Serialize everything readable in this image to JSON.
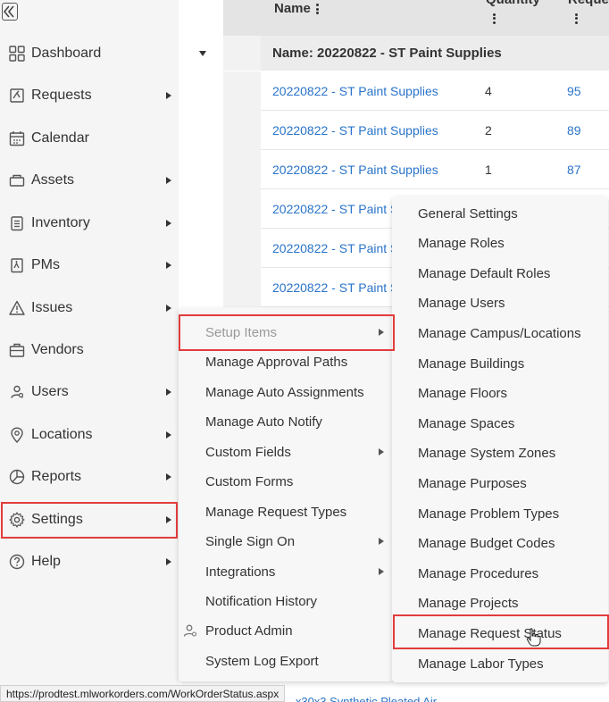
{
  "sidebar": {
    "items": [
      {
        "label": "Dashboard",
        "icon": "dashboard-icon",
        "arrow": false
      },
      {
        "label": "Requests",
        "icon": "requests-icon",
        "arrow": true
      },
      {
        "label": "Calendar",
        "icon": "calendar-icon",
        "arrow": false
      },
      {
        "label": "Assets",
        "icon": "assets-icon",
        "arrow": true
      },
      {
        "label": "Inventory",
        "icon": "inventory-icon",
        "arrow": true
      },
      {
        "label": "PMs",
        "icon": "pms-icon",
        "arrow": true
      },
      {
        "label": "Issues",
        "icon": "issues-icon",
        "arrow": true
      },
      {
        "label": "Vendors",
        "icon": "vendors-icon",
        "arrow": false
      },
      {
        "label": "Users",
        "icon": "users-icon",
        "arrow": true
      },
      {
        "label": "Locations",
        "icon": "location-pin-icon",
        "arrow": true
      },
      {
        "label": "Reports",
        "icon": "reports-icon",
        "arrow": true
      },
      {
        "label": "Settings",
        "icon": "gear-icon",
        "arrow": true
      },
      {
        "label": "Help",
        "icon": "help-icon",
        "arrow": true
      }
    ]
  },
  "grid": {
    "columns": {
      "name": "Name",
      "quantity": "Quantity",
      "request": "Reque"
    },
    "group_label": "Name: 20220822 - ST Paint Supplies",
    "rows": [
      {
        "name": "20220822 - ST Paint Supplies",
        "quantity": "4",
        "request": "95"
      },
      {
        "name": "20220822 - ST Paint Supplies",
        "quantity": "2",
        "request": "89"
      },
      {
        "name": "20220822 - ST Paint Supplies",
        "quantity": "1",
        "request": "87"
      },
      {
        "name": "20220822 - ST Paint S",
        "quantity": "",
        "request": ""
      },
      {
        "name": "20220822 - ST Paint S",
        "quantity": "",
        "request": ""
      },
      {
        "name": "20220822 - ST Paint S",
        "quantity": "",
        "request": ""
      }
    ],
    "bottom_peek": "...x30x3 Synthetic Pleated Air"
  },
  "settings_menu": {
    "items": [
      {
        "label": "Setup Items",
        "arrow": true,
        "disabled": true
      },
      {
        "label": "Manage Approval Paths",
        "arrow": false
      },
      {
        "label": "Manage Auto Assignments",
        "arrow": false
      },
      {
        "label": "Manage Auto Notify",
        "arrow": false
      },
      {
        "label": "Custom Fields",
        "arrow": true
      },
      {
        "label": "Custom Forms",
        "arrow": false
      },
      {
        "label": "Manage Request Types",
        "arrow": false
      },
      {
        "label": "Single Sign On",
        "arrow": true
      },
      {
        "label": "Integrations",
        "arrow": true
      },
      {
        "label": "Notification History",
        "arrow": false
      },
      {
        "label": "Product Admin",
        "arrow": false,
        "icon": "user-admin-icon"
      },
      {
        "label": "System Log Export",
        "arrow": false
      }
    ]
  },
  "setup_menu": {
    "items": [
      "General Settings",
      "Manage Roles",
      "Manage Default Roles",
      "Manage Users",
      "Manage Campus/Locations",
      "Manage Buildings",
      "Manage Floors",
      "Manage Spaces",
      "Manage System Zones",
      "Manage Purposes",
      "Manage Problem Types",
      "Manage Budget Codes",
      "Manage Procedures",
      "Manage Projects",
      "Manage Request Status",
      "Manage Labor Types"
    ]
  },
  "status_bar": {
    "url": "https://prodtest.mlworkorders.com/WorkOrderStatus.aspx"
  },
  "colors": {
    "highlight": "#e23b3b",
    "link": "#2a74c9"
  }
}
